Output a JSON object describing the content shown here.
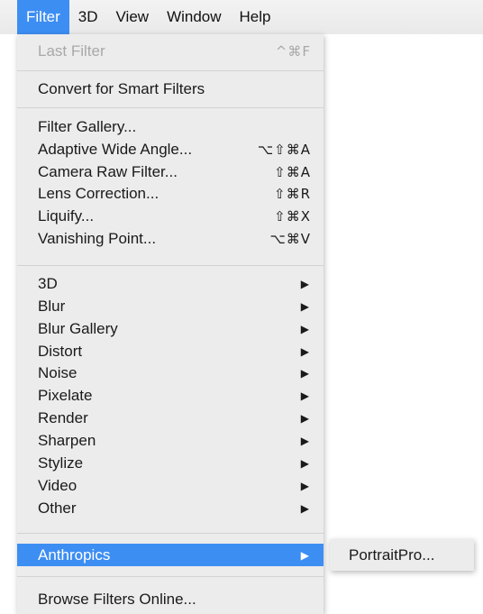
{
  "menubar": {
    "items": [
      {
        "label": "Filter",
        "active": true
      },
      {
        "label": "3D"
      },
      {
        "label": "View"
      },
      {
        "label": "Window"
      },
      {
        "label": "Help"
      }
    ]
  },
  "filter_menu": {
    "last_filter": {
      "label": "Last Filter",
      "shortcut": "^⌘F",
      "enabled": false
    },
    "convert_smart": {
      "label": "Convert for Smart Filters"
    },
    "filter_items": [
      {
        "label": "Filter Gallery...",
        "shortcut": ""
      },
      {
        "label": "Adaptive Wide Angle...",
        "shortcut": "⌥⇧⌘A"
      },
      {
        "label": "Camera Raw Filter...",
        "shortcut": "⇧⌘A"
      },
      {
        "label": "Lens Correction...",
        "shortcut": "⇧⌘R"
      },
      {
        "label": "Liquify...",
        "shortcut": "⇧⌘X"
      },
      {
        "label": "Vanishing Point...",
        "shortcut": "⌥⌘V"
      }
    ],
    "submenu_arrow": "▶",
    "submenus": [
      {
        "label": "3D"
      },
      {
        "label": "Blur"
      },
      {
        "label": "Blur Gallery"
      },
      {
        "label": "Distort"
      },
      {
        "label": "Noise"
      },
      {
        "label": "Pixelate"
      },
      {
        "label": "Render"
      },
      {
        "label": "Sharpen"
      },
      {
        "label": "Stylize"
      },
      {
        "label": "Video"
      },
      {
        "label": "Other"
      }
    ],
    "anthropics": {
      "label": "Anthropics",
      "highlighted": true
    },
    "browse": {
      "label": "Browse Filters Online..."
    }
  },
  "anthropics_submenu": {
    "items": [
      {
        "label": "PortraitPro..."
      }
    ]
  },
  "colors": {
    "highlight": "#3d8ef3",
    "menu_background": "#ececec",
    "disabled_text": "#a8a8a8"
  }
}
